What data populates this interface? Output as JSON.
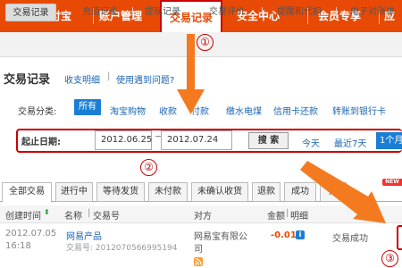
{
  "top_nav": {
    "items": [
      "我的支付宝",
      "账户管理",
      "交易记录",
      "安全中心",
      "会员专享",
      "应"
    ]
  },
  "sub_nav": {
    "items": [
      "交易记录",
      "充值记录",
      "提现记录",
      "交易评价",
      "提醒和代扣",
      "电子对账单"
    ]
  },
  "page": {
    "title": "交易记录",
    "link_detail": "收支明细",
    "link_help": "使用遇到问题?"
  },
  "categories": {
    "label": "交易分类:",
    "items": [
      "所有",
      "淘宝购物",
      "收款",
      "付款",
      "缴水电煤",
      "信用卡还款",
      "转账到银行卡"
    ]
  },
  "date_filter": {
    "label": "起止日期:",
    "start": "2012.06.25",
    "end": "2012.07.24",
    "search_button": "搜 索",
    "quick": [
      "今天",
      "最近7天",
      "1个月"
    ]
  },
  "tabs": {
    "items": [
      "全部交易",
      "进行中",
      "等待发货",
      "未付款",
      "未确认收货",
      "退款",
      "成功",
      "失"
    ],
    "new_badge": "NEW"
  },
  "table": {
    "headers": [
      "创建时间",
      "名称",
      "交易号",
      "对方",
      "金额",
      "明细"
    ],
    "row": {
      "date": "2012.07.05",
      "time": "16:18",
      "name": "网易产品",
      "txn": "交易号: 2012070566995194",
      "party_line1": "网易宝有限公",
      "party_line2": "司",
      "amount": "-0.01",
      "status": "交易成功"
    }
  },
  "annotations": {
    "marker_1": "①",
    "marker_2": "②",
    "marker_3": "③"
  },
  "colors": {
    "brand_orange": "#e84a06",
    "link_blue": "#1a66b3",
    "highlight_red": "#cc0000"
  }
}
